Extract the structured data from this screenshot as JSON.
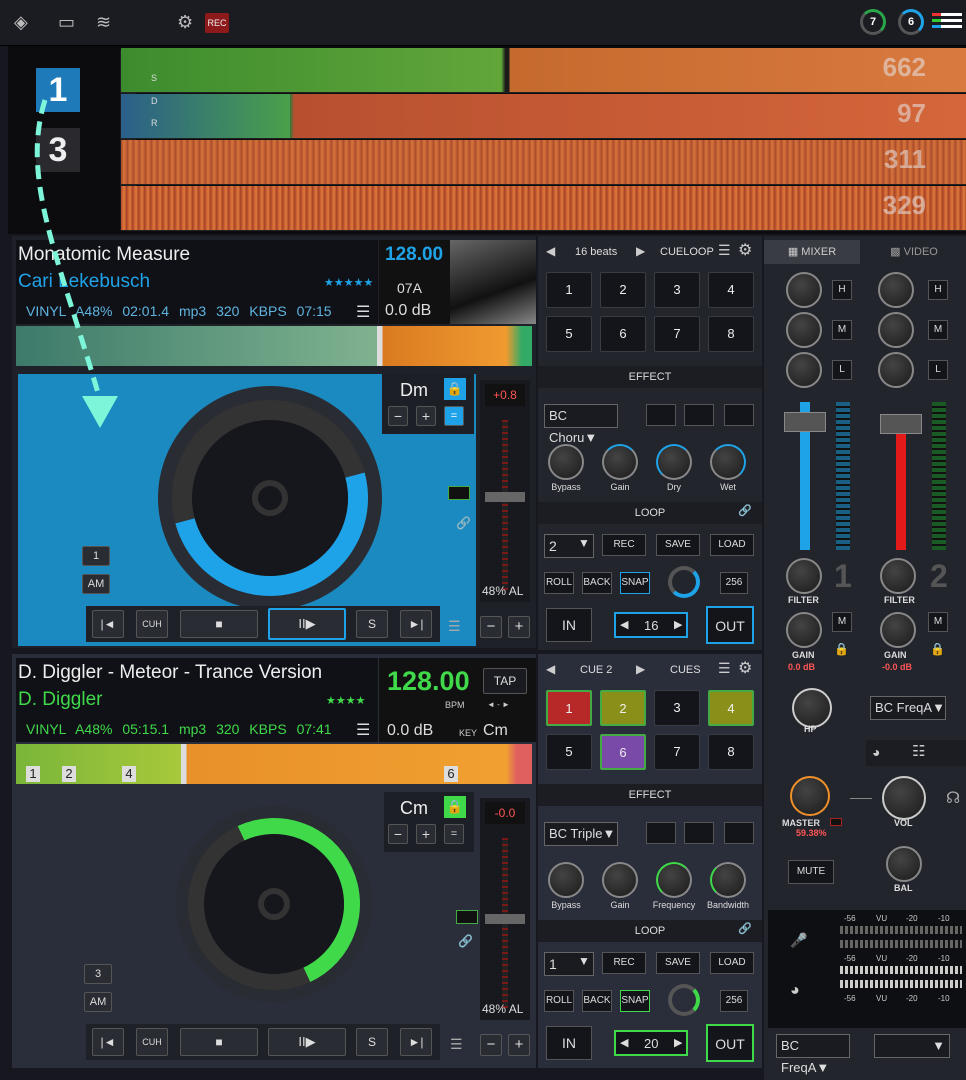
{
  "topbar": {
    "rec_label": "REC",
    "ring1": "7",
    "ring2": "6"
  },
  "overview": {
    "deck_labels": [
      "1",
      "3"
    ],
    "rows": [
      {
        "bpm": "662",
        "letters": "S"
      },
      {
        "bpm": "97",
        "letters": "D"
      },
      {
        "bpm": "311",
        "letters": "R"
      },
      {
        "bpm": "329",
        "letters": ""
      }
    ]
  },
  "deck1": {
    "title": "Monatomic Measure",
    "artist": "Cari Lekebusch",
    "stars": "★★★★★",
    "info": {
      "mode": "VINYL",
      "pitch": "A48%",
      "elapsed": "02:01.4",
      "format": "mp3",
      "bitrate": "320 KBPS",
      "remaining": "07:15"
    },
    "bpm": "128.00",
    "key_code": "07A",
    "gain": "0.0 dB",
    "key": "Dm",
    "pitch_value": "+0.8",
    "pitch_range": "48% AL",
    "deck_num": "1",
    "mode_am": "AM",
    "transport": {
      "prev": "|◄",
      "cue": "CUH",
      "stop": "■",
      "play": "II▶",
      "sync": "S",
      "next": "►|"
    },
    "accent": "#1fa3e8"
  },
  "deck2": {
    "title": "D. Diggler - Meteor - Trance Version",
    "artist": "D. Diggler",
    "stars": "★★★★",
    "info": {
      "mode": "VINYL",
      "pitch": "A48%",
      "elapsed": "05:15.1",
      "format": "mp3",
      "bitrate": "320 KBPS",
      "remaining": "07:41"
    },
    "bpm": "128.00",
    "bpm_unit": "BPM",
    "tap": "TAP",
    "gain": "0.0 dB",
    "key_label": "KEY",
    "key_value": "Cm",
    "key": "Cm",
    "pitch_value": "-0.0",
    "pitch_range": "48% AL",
    "deck_num": "3",
    "mode_am": "AM",
    "cue_markers": [
      "1",
      "2",
      "4",
      "6"
    ],
    "transport": {
      "prev": "|◄",
      "cue": "CUH",
      "stop": "■",
      "play": "II▶",
      "sync": "S",
      "next": "►|"
    },
    "accent": "#3fd94a"
  },
  "pads1": {
    "header": "16 beats",
    "mode": "CUELOOP",
    "labels": [
      "1",
      "2",
      "3",
      "4",
      "5",
      "6",
      "7",
      "8"
    ]
  },
  "pads2": {
    "header": "CUE 2",
    "mode": "CUES",
    "labels": [
      "1",
      "2",
      "3",
      "4",
      "5",
      "6",
      "7",
      "8"
    ]
  },
  "effect1": {
    "section": "EFFECT",
    "name": "BC Choru▼",
    "knobs": [
      "Bypass",
      "Gain",
      "Dry",
      "Wet"
    ]
  },
  "effect2": {
    "section": "EFFECT",
    "name": "BC Triple▼",
    "knobs": [
      "Bypass",
      "Gain",
      "Frequency",
      "Bandwidth"
    ]
  },
  "loop1": {
    "section": "LOOP",
    "size": "2",
    "rec": "REC",
    "save": "SAVE",
    "load": "LOAD",
    "roll": "ROLL",
    "back": "BACK",
    "snap": "SNAP",
    "beats": "256",
    "in": "IN",
    "length": "16",
    "out": "OUT"
  },
  "loop2": {
    "section": "LOOP",
    "size": "1",
    "rec": "REC",
    "save": "SAVE",
    "load": "LOAD",
    "roll": "ROLL",
    "back": "BACK",
    "snap": "SNAP",
    "beats": "256",
    "in": "IN",
    "length": "20",
    "out": "OUT"
  },
  "mixer": {
    "tab_mixer": "MIXER",
    "tab_video": "VIDEO",
    "eq": [
      "H",
      "M",
      "L"
    ],
    "ch1_num": "1",
    "ch2_num": "2",
    "filter": "FILTER",
    "gain": "GAIN",
    "m": "M",
    "gain1": "0.0 dB",
    "gain2": "-0.0 dB",
    "hp": "HP",
    "fx_sel": "BC FreqA▼",
    "master": "MASTER",
    "master_val": "59.38%",
    "vol": "VOL",
    "mute": "MUTE",
    "bal": "BAL",
    "vu_scale": [
      "-56",
      "VU",
      "-20",
      "-10"
    ],
    "bottom_sel": "BC FreqA▼"
  }
}
